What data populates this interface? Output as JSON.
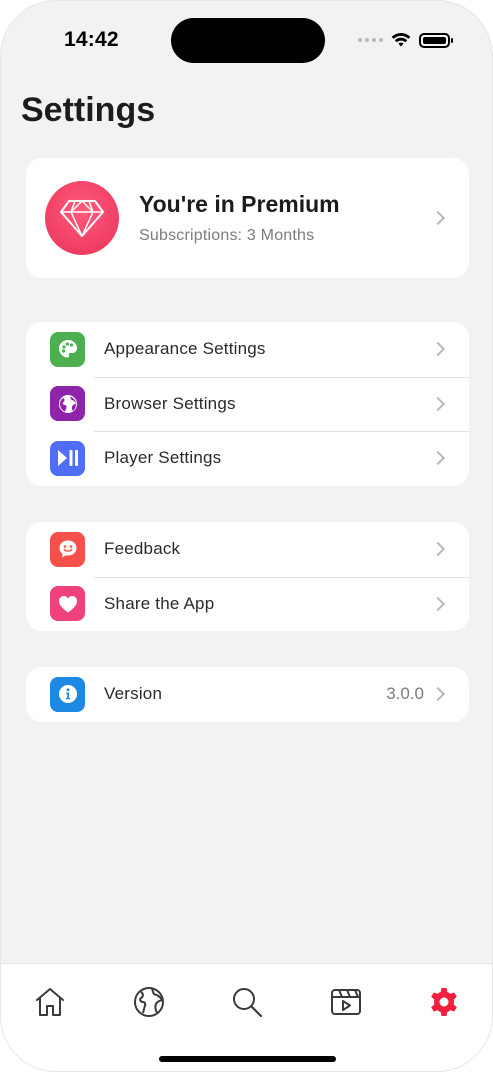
{
  "status_bar": {
    "time": "14:42"
  },
  "page": {
    "title": "Settings"
  },
  "premium": {
    "title": "You're in Premium",
    "subtitle": "Subscriptions: 3 Months"
  },
  "groups": [
    {
      "items": [
        {
          "label": "Appearance Settings",
          "icon": "palette-icon",
          "color": "#4caf50"
        },
        {
          "label": "Browser Settings",
          "icon": "globe-icon",
          "color": "#8e24aa"
        },
        {
          "label": "Player Settings",
          "icon": "play-pause-icon",
          "color": "#4f6df5"
        }
      ]
    },
    {
      "items": [
        {
          "label": "Feedback",
          "icon": "feedback-icon",
          "color": "#f4514a"
        },
        {
          "label": "Share the App",
          "icon": "heart-icon",
          "color": "#f0427a"
        }
      ]
    },
    {
      "items": [
        {
          "label": "Version",
          "value": "3.0.0",
          "icon": "info-icon",
          "color": "#1e88e5"
        }
      ]
    }
  ],
  "tabbar": {
    "tabs": [
      {
        "icon": "home-icon",
        "active": false
      },
      {
        "icon": "globe-icon",
        "active": false
      },
      {
        "icon": "search-icon",
        "active": false
      },
      {
        "icon": "video-icon",
        "active": false
      },
      {
        "icon": "gear-icon",
        "active": true
      }
    ],
    "active_color": "#f0203e",
    "inactive_color": "#3a3a3c"
  }
}
